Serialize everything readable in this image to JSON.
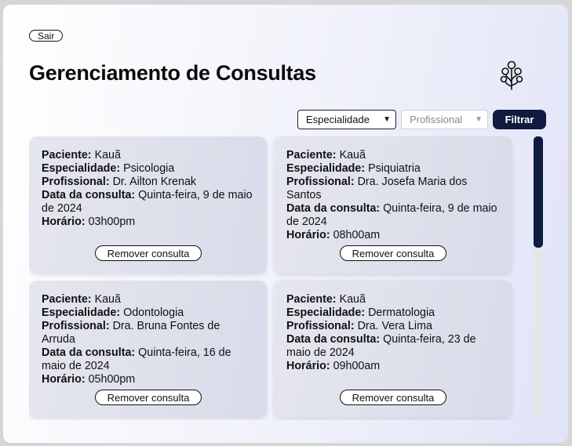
{
  "header": {
    "logout_label": "Sair",
    "title": "Gerenciamento de Consultas",
    "logo_icon": "tree-icon"
  },
  "filters": {
    "specialty_selected": "Especialidade",
    "professional_selected": "Profissional",
    "filter_label": "Filtrar"
  },
  "labels": {
    "patient": "Paciente:",
    "specialty": "Especialidade:",
    "professional": "Profissional:",
    "date": "Data da consulta:",
    "time": "Horário:"
  },
  "appointments": [
    {
      "patient": "Kauã",
      "specialty": "Psicologia",
      "professional": "Dr. Ailton Krenak",
      "date": "Quinta-feira, 9 de maio de 2024",
      "time": "03h00pm",
      "remove_label": "Remover consulta"
    },
    {
      "patient": "Kauã",
      "specialty": "Psiquiatria",
      "professional": "Dra. Josefa Maria dos Santos",
      "date": "Quinta-feira, 9 de maio de 2024",
      "time": "08h00am",
      "remove_label": "Remover consulta"
    },
    {
      "patient": "Kauã",
      "specialty": "Odontologia",
      "professional": "Dra. Bruna Fontes de Arruda",
      "date": "Quinta-feira, 16 de maio de 2024",
      "time": "05h00pm",
      "remove_label": "Remover consulta"
    },
    {
      "patient": "Kauã",
      "specialty": "Dermatologia",
      "professional": "Dra. Vera Lima",
      "date": "Quinta-feira, 23 de maio de 2024",
      "time": "09h00am",
      "remove_label": "Remover consulta"
    }
  ],
  "colors": {
    "accent": "#0f1b3f",
    "card_bg": "#dfe1ec"
  }
}
